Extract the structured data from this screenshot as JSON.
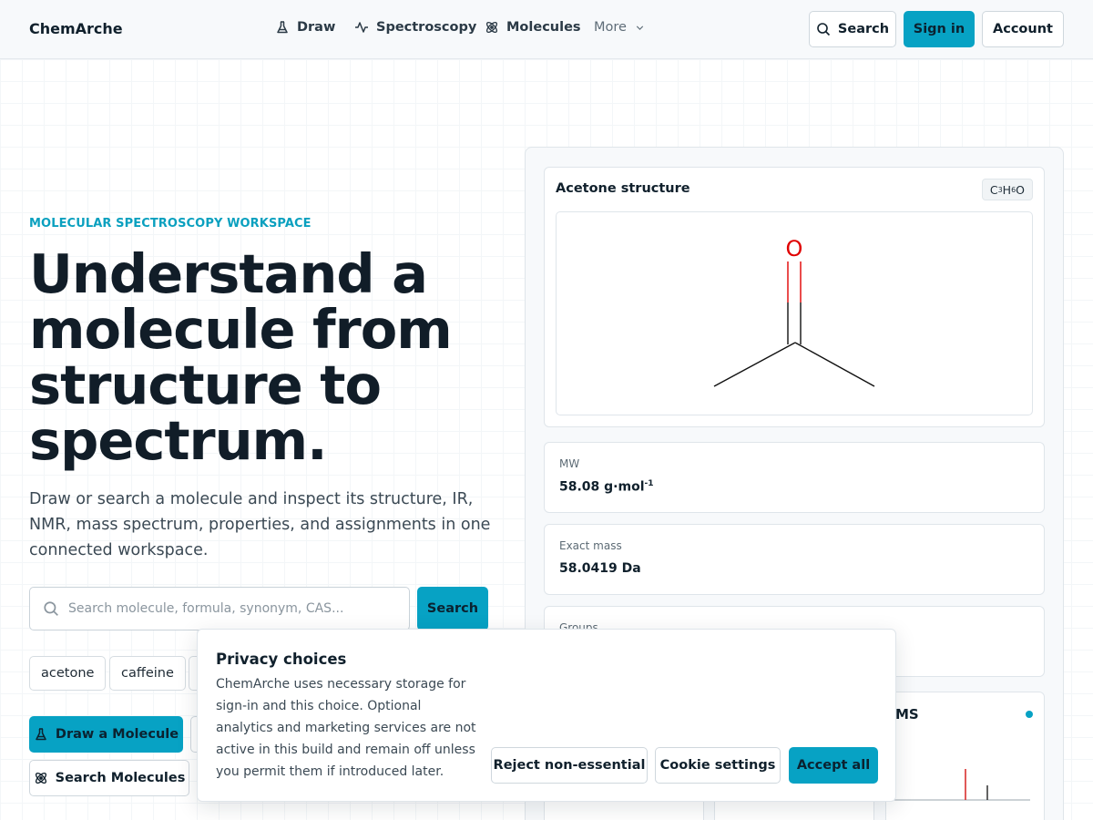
{
  "nav": {
    "brand": "ChemArche",
    "links": [
      {
        "label": "Draw",
        "icon": "flask-icon"
      },
      {
        "label": "Spectroscopy",
        "icon": "pulse-icon"
      },
      {
        "label": "Molecules",
        "icon": "atom-icon"
      }
    ],
    "more_label": "More",
    "search_label": "Search",
    "signin_label": "Sign in",
    "account_label": "Account"
  },
  "hero": {
    "eyebrow": "MOLECULAR SPECTROSCOPY WORKSPACE",
    "title": "Understand a molecule from structure to spectrum.",
    "subtitle": "Draw or search a molecule and inspect its structure, IR, NMR, mass spectrum, properties, and assignments in one connected workspace.",
    "search_placeholder": "Search molecule, formula, synonym, CAS...",
    "search_button": "Search",
    "chips": [
      "acetone",
      "caffeine"
    ],
    "draw_button": "Draw a Molecule",
    "search_molecules_button": "Search Molecules"
  },
  "panel": {
    "structure": {
      "title": "Acetone structure",
      "formula": "C3H6O",
      "oxygen_label": "O"
    },
    "mw": {
      "label": "MW",
      "value": "58.08 g·mol",
      "unit_exponent": "-1"
    },
    "exact_mass": {
      "label": "Exact mass",
      "value": "58.0419 Da"
    },
    "groups": {
      "label": "Groups"
    },
    "ms_card": {
      "title_visible": "MS"
    }
  },
  "cookie": {
    "title": "Privacy choices",
    "body": "ChemArche uses necessary storage for sign-in and this choice. Optional analytics and marketing services are not active in this build and remain off unless you permit them if introduced later.",
    "reject_label": "Reject non-essential",
    "settings_label": "Cookie settings",
    "accept_label": "Accept all"
  },
  "colors": {
    "accent": "#07a2c4",
    "eyebrow": "#0aa0bf",
    "oxygen": "#e00000",
    "ms_dot": "#07a2c4"
  }
}
